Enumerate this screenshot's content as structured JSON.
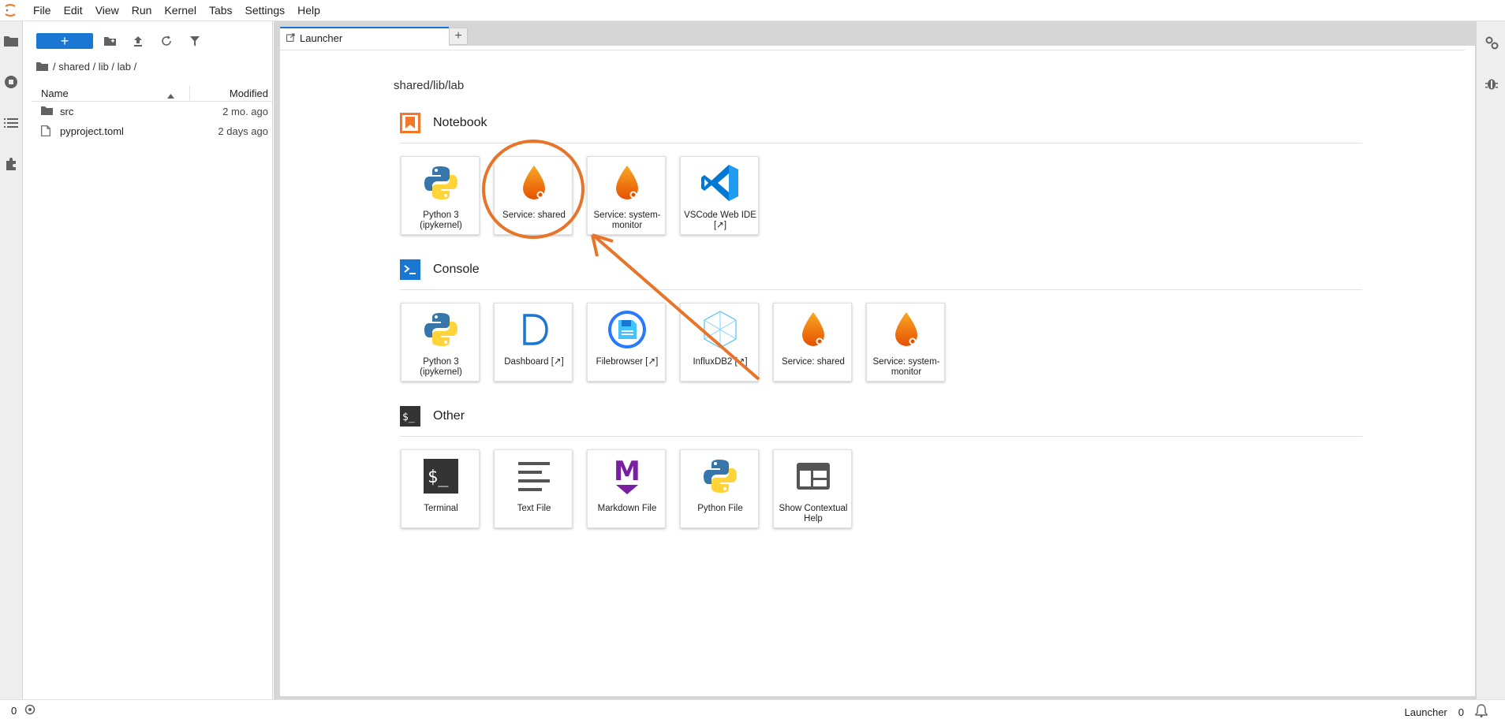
{
  "menu": [
    "File",
    "Edit",
    "View",
    "Run",
    "Kernel",
    "Tabs",
    "Settings",
    "Help"
  ],
  "filebrowser": {
    "new_label": "+",
    "breadcrumb": "/ shared / lib / lab /",
    "header": {
      "name": "Name",
      "modified": "Modified"
    },
    "rows": [
      {
        "name": "src",
        "modified": "2 mo. ago",
        "icon": "folder-icon"
      },
      {
        "name": "pyproject.toml",
        "modified": "2 days ago",
        "icon": "file-icon"
      }
    ]
  },
  "tabs": [
    {
      "label": "Launcher"
    }
  ],
  "add_tab_label": "+",
  "launcher": {
    "path": "shared/lib/lab",
    "sections": [
      {
        "title": "Notebook",
        "items": [
          {
            "label": "Python 3 (ipykernel)",
            "icon": "python-icon"
          },
          {
            "label": "Service: shared",
            "icon": "drop-icon"
          },
          {
            "label": "Service: system-monitor",
            "icon": "drop-icon"
          },
          {
            "label": "VSCode Web IDE [↗]",
            "icon": "vscode-icon"
          }
        ]
      },
      {
        "title": "Console",
        "items": [
          {
            "label": "Python 3 (ipykernel)",
            "icon": "python-icon"
          },
          {
            "label": "Dashboard [↗]",
            "icon": "dashboard-icon"
          },
          {
            "label": "Filebrowser [↗]",
            "icon": "filebrowser-icon"
          },
          {
            "label": "InfluxDB2 [↗]",
            "icon": "influxdb-icon"
          },
          {
            "label": "Service: shared",
            "icon": "drop-icon"
          },
          {
            "label": "Service: system-monitor",
            "icon": "drop-icon"
          }
        ]
      },
      {
        "title": "Other",
        "items": [
          {
            "label": "Terminal",
            "icon": "terminal-icon"
          },
          {
            "label": "Text File",
            "icon": "text-file-icon"
          },
          {
            "label": "Markdown File",
            "icon": "markdown-icon"
          },
          {
            "label": "Python File",
            "icon": "python-file-icon"
          },
          {
            "label": "Show Contextual Help",
            "icon": "contextual-help-icon"
          }
        ]
      }
    ]
  },
  "statusbar": {
    "left_count": "0",
    "right_label": "Launcher",
    "right_count": "0"
  },
  "colors": {
    "accent": "#1976d2",
    "annotation": "#e8742a",
    "notebook_icon": "#f37726"
  }
}
